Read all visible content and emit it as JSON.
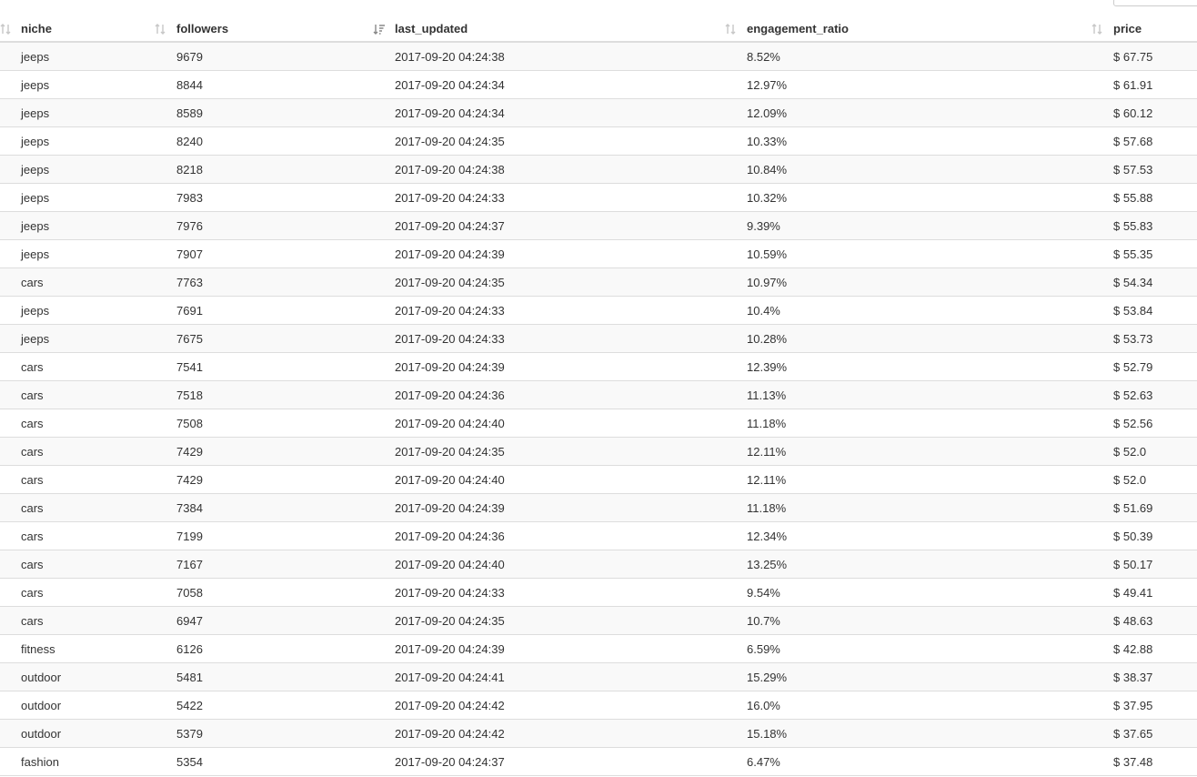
{
  "table": {
    "columns": [
      {
        "key": "niche",
        "label": "niche",
        "sort": "none"
      },
      {
        "key": "followers",
        "label": "followers",
        "sort": "none"
      },
      {
        "key": "last_updated",
        "label": "last_updated",
        "sort": "none"
      },
      {
        "key": "engagement_ratio",
        "label": "engagement_ratio",
        "sort": "none"
      },
      {
        "key": "price",
        "label": "price",
        "sort": "descending"
      }
    ],
    "rows": [
      {
        "niche": "jeeps",
        "followers": "9679",
        "last_updated": "2017-09-20 04:24:38",
        "engagement_ratio": "8.52%",
        "price": "$ 67.75"
      },
      {
        "niche": "jeeps",
        "followers": "8844",
        "last_updated": "2017-09-20 04:24:34",
        "engagement_ratio": "12.97%",
        "price": "$ 61.91"
      },
      {
        "niche": "jeeps",
        "followers": "8589",
        "last_updated": "2017-09-20 04:24:34",
        "engagement_ratio": "12.09%",
        "price": "$ 60.12"
      },
      {
        "niche": "jeeps",
        "followers": "8240",
        "last_updated": "2017-09-20 04:24:35",
        "engagement_ratio": "10.33%",
        "price": "$ 57.68"
      },
      {
        "niche": "jeeps",
        "followers": "8218",
        "last_updated": "2017-09-20 04:24:38",
        "engagement_ratio": "10.84%",
        "price": "$ 57.53"
      },
      {
        "niche": "jeeps",
        "followers": "7983",
        "last_updated": "2017-09-20 04:24:33",
        "engagement_ratio": "10.32%",
        "price": "$ 55.88"
      },
      {
        "niche": "jeeps",
        "followers": "7976",
        "last_updated": "2017-09-20 04:24:37",
        "engagement_ratio": "9.39%",
        "price": "$ 55.83"
      },
      {
        "niche": "jeeps",
        "followers": "7907",
        "last_updated": "2017-09-20 04:24:39",
        "engagement_ratio": "10.59%",
        "price": "$ 55.35"
      },
      {
        "niche": "cars",
        "followers": "7763",
        "last_updated": "2017-09-20 04:24:35",
        "engagement_ratio": "10.97%",
        "price": "$ 54.34"
      },
      {
        "niche": "jeeps",
        "followers": "7691",
        "last_updated": "2017-09-20 04:24:33",
        "engagement_ratio": "10.4%",
        "price": "$ 53.84"
      },
      {
        "niche": "jeeps",
        "followers": "7675",
        "last_updated": "2017-09-20 04:24:33",
        "engagement_ratio": "10.28%",
        "price": "$ 53.73"
      },
      {
        "niche": "cars",
        "followers": "7541",
        "last_updated": "2017-09-20 04:24:39",
        "engagement_ratio": "12.39%",
        "price": "$ 52.79"
      },
      {
        "niche": "cars",
        "followers": "7518",
        "last_updated": "2017-09-20 04:24:36",
        "engagement_ratio": "11.13%",
        "price": "$ 52.63"
      },
      {
        "niche": "cars",
        "followers": "7508",
        "last_updated": "2017-09-20 04:24:40",
        "engagement_ratio": "11.18%",
        "price": "$ 52.56"
      },
      {
        "niche": "cars",
        "followers": "7429",
        "last_updated": "2017-09-20 04:24:35",
        "engagement_ratio": "12.11%",
        "price": "$ 52.0"
      },
      {
        "niche": "cars",
        "followers": "7429",
        "last_updated": "2017-09-20 04:24:40",
        "engagement_ratio": "12.11%",
        "price": "$ 52.0"
      },
      {
        "niche": "cars",
        "followers": "7384",
        "last_updated": "2017-09-20 04:24:39",
        "engagement_ratio": "11.18%",
        "price": "$ 51.69"
      },
      {
        "niche": "cars",
        "followers": "7199",
        "last_updated": "2017-09-20 04:24:36",
        "engagement_ratio": "12.34%",
        "price": "$ 50.39"
      },
      {
        "niche": "cars",
        "followers": "7167",
        "last_updated": "2017-09-20 04:24:40",
        "engagement_ratio": "13.25%",
        "price": "$ 50.17"
      },
      {
        "niche": "cars",
        "followers": "7058",
        "last_updated": "2017-09-20 04:24:33",
        "engagement_ratio": "9.54%",
        "price": "$ 49.41"
      },
      {
        "niche": "cars",
        "followers": "6947",
        "last_updated": "2017-09-20 04:24:35",
        "engagement_ratio": "10.7%",
        "price": "$ 48.63"
      },
      {
        "niche": "fitness",
        "followers": "6126",
        "last_updated": "2017-09-20 04:24:39",
        "engagement_ratio": "6.59%",
        "price": "$ 42.88"
      },
      {
        "niche": "outdoor",
        "followers": "5481",
        "last_updated": "2017-09-20 04:24:41",
        "engagement_ratio": "15.29%",
        "price": "$ 38.37"
      },
      {
        "niche": "outdoor",
        "followers": "5422",
        "last_updated": "2017-09-20 04:24:42",
        "engagement_ratio": "16.0%",
        "price": "$ 37.95"
      },
      {
        "niche": "outdoor",
        "followers": "5379",
        "last_updated": "2017-09-20 04:24:42",
        "engagement_ratio": "15.18%",
        "price": "$ 37.65"
      },
      {
        "niche": "fashion",
        "followers": "5354",
        "last_updated": "2017-09-20 04:24:37",
        "engagement_ratio": "6.47%",
        "price": "$ 37.48"
      }
    ]
  },
  "icons": {
    "sort_unsorted": "sort-both-icon",
    "sort_active": "sort-descending-icon"
  },
  "colors": {
    "stripe": "#f9f9f9",
    "border": "#dddddd",
    "icon": "#bbbbbb",
    "icon_active": "#888888"
  }
}
